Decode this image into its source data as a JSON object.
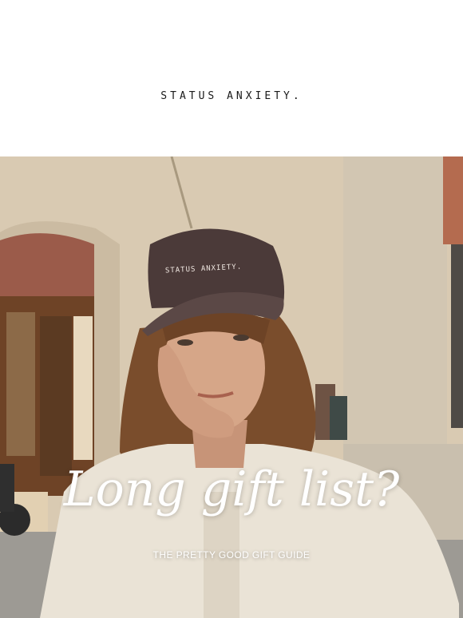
{
  "header": {
    "brand": "STATUS ANXIETY."
  },
  "hero": {
    "cap_text": "STATUS ANXIETY.",
    "headline": "Long gift list?",
    "subheadline": "THE PRETTY GOOD GIFT GUIDE"
  },
  "colors": {
    "background": "#ffffff",
    "brand_text": "#1a1a1a",
    "hero_text": "#ffffff",
    "cap": "#4b3a39",
    "shirt": "#e9e2d4",
    "wall": "#d8c9b0"
  }
}
